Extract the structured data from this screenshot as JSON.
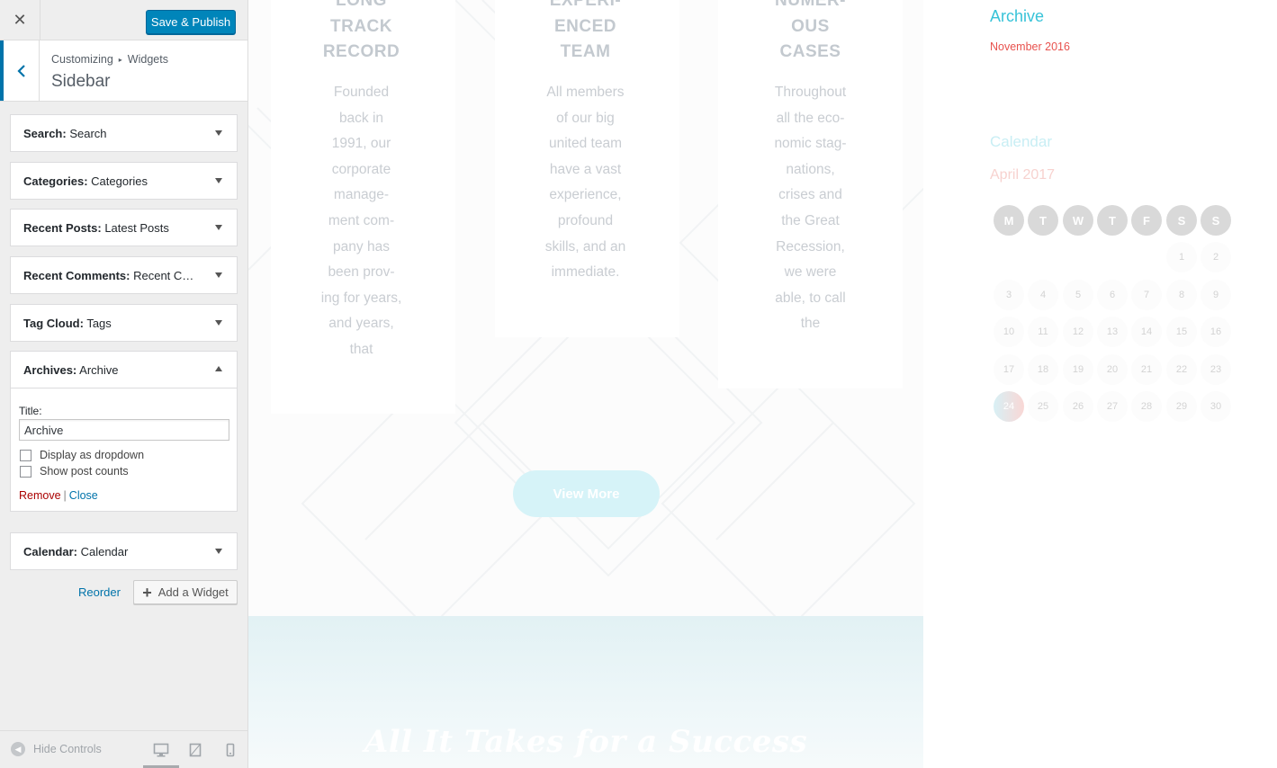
{
  "customizer": {
    "publish_label": "Save & Publish",
    "breadcrumb": [
      "Customizing",
      "Widgets"
    ],
    "breadcrumb_sep": "▸",
    "section_title": "Sidebar",
    "widgets": [
      {
        "type": "Search:",
        "title": "Search"
      },
      {
        "type": "Categories:",
        "title": "Categories"
      },
      {
        "type": "Recent Posts:",
        "title": "Latest Posts"
      },
      {
        "type": "Recent Comments:",
        "title": "Recent Com..."
      },
      {
        "type": "Tag Cloud:",
        "title": "Tags"
      },
      {
        "type": "Archives:",
        "title": "Archive"
      },
      {
        "type": "Calendar:",
        "title": "Calendar"
      }
    ],
    "archive_form": {
      "title_label": "Title:",
      "title_value": "Archive",
      "checkbox_dropdown": "Display as dropdown",
      "checkbox_counts": "Show post counts",
      "remove": "Remove",
      "separator": "|",
      "close": "Close"
    },
    "reorder": "Reorder",
    "add_widget": "Add a Widget",
    "hide_controls": "Hide Controls"
  },
  "preview": {
    "features": [
      {
        "title": [
          "LONG",
          "TRACK",
          "RECORD"
        ],
        "text": [
          "Founded",
          "back in",
          "1991, our",
          "corporate",
          "manage-",
          "ment com-",
          "pany has",
          "been prov-",
          "ing for years,",
          "and years,",
          "that"
        ]
      },
      {
        "title": [
          "EXPERI-",
          "ENCED",
          "TEAM"
        ],
        "text": [
          "All members",
          "of our big",
          "united team",
          "have a vast",
          "experience,",
          "profound",
          "skills, and an",
          "immediate."
        ]
      },
      {
        "title": [
          "NUMER-",
          "OUS",
          "CASES"
        ],
        "text": [
          "Throughout",
          "all the eco-",
          "nomic stag-",
          "nations,",
          "crises and",
          "the Great",
          "Recession,",
          "we were",
          "able, to call",
          "the"
        ]
      }
    ],
    "view_more": "View More",
    "banner_text": "All It Takes for a Success"
  },
  "sidebar": {
    "archive_title": "Archive",
    "archive_item": "November 2016",
    "calendar_title": "Calendar",
    "calendar_month": "April 2017",
    "weekdays": [
      "M",
      "T",
      "W",
      "T",
      "F",
      "S",
      "S"
    ],
    "weeks": [
      [
        "",
        "",
        "",
        "",
        "",
        "1",
        "2"
      ],
      [
        "3",
        "4",
        "5",
        "6",
        "7",
        "8",
        "9"
      ],
      [
        "10",
        "11",
        "12",
        "13",
        "14",
        "15",
        "16"
      ],
      [
        "17",
        "18",
        "19",
        "20",
        "21",
        "22",
        "23"
      ],
      [
        "24",
        "25",
        "26",
        "27",
        "28",
        "29",
        "30"
      ]
    ],
    "today": "24"
  },
  "colors": {
    "accent": "#0073aa",
    "publish": "#0085ba",
    "archive_title": "#38c3d8",
    "archive_link": "#e8524e"
  }
}
